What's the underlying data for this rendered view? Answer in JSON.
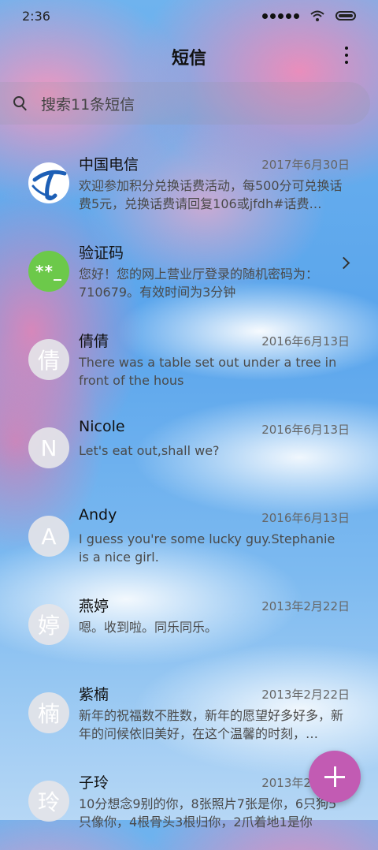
{
  "status_bar": {
    "time": "2:36"
  },
  "header": {
    "title": "短信",
    "more_icon": "more-vertical-icon"
  },
  "search": {
    "placeholder": "搜索11条短信"
  },
  "conversations": [
    {
      "name": "中国电信",
      "date": "2017年6月30日",
      "preview": "欢迎参加积分兑换话费活动，每500分可兑换话费5元，兑换话费请回复106或jfdh#话费…",
      "avatar": ""
    },
    {
      "name": "验证码",
      "date": "",
      "preview": "您好！您的网上营业厅登录的随机密码为：710679。有效时间为3分钟",
      "avatar": "**_"
    },
    {
      "name": "倩倩",
      "date": "2016年6月13日",
      "preview": "There was a table set out under a tree in front of the hous",
      "avatar": "倩"
    },
    {
      "name": "Nicole",
      "date": "2016年6月13日",
      "preview": "Let's eat out,shall we?",
      "avatar": "N"
    },
    {
      "name": "Andy",
      "date": "2016年6月13日",
      "preview": "I guess you're some lucky guy.Stephanie is a nice girl.",
      "avatar": "A"
    },
    {
      "name": "燕婷",
      "date": "2013年2月22日",
      "preview": "嗯。收到啦。同乐同乐。",
      "avatar": "婷"
    },
    {
      "name": "紫楠",
      "date": "2013年2月22日",
      "preview": "新年的祝福数不胜数，新年的愿望好多好多，新年的问候依旧美好，在这个温馨的时刻，…",
      "avatar": "楠"
    },
    {
      "name": "子玲",
      "date": "2013年2月22日",
      "preview": "10分想念9别的你，8张照片7张是你，6只狗5只像你，4根骨头3根归你，2爪着地1是你",
      "avatar": "玲"
    }
  ],
  "fab": {
    "icon": "plus-icon"
  }
}
